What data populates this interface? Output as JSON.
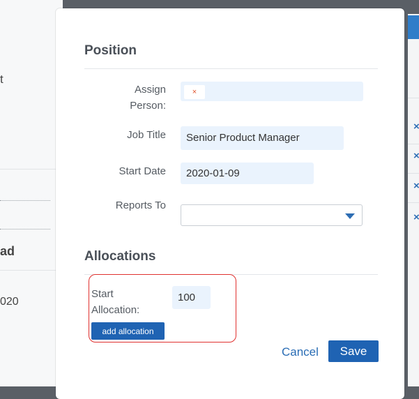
{
  "background": {
    "left_texts": [
      "t",
      "ad",
      "020"
    ]
  },
  "modal": {
    "position_section": {
      "title": "Position",
      "assign_person_label_line1": "Assign",
      "assign_person_label_line2": "Person:",
      "assign_person_chip_remove": "×",
      "job_title_label": "Job Title",
      "job_title_value": "Senior Product Manager",
      "start_date_label": "Start Date",
      "start_date_value": "2020-01-09",
      "reports_to_label": "Reports To",
      "reports_to_value": ""
    },
    "allocations_section": {
      "title": "Allocations",
      "start_allocation_label_line1": "Start",
      "start_allocation_label_line2": "Allocation:",
      "start_allocation_value": "100",
      "add_allocation_label": "add allocation"
    },
    "footer": {
      "cancel_label": "Cancel",
      "save_label": "Save"
    }
  },
  "colors": {
    "accent": "#1f63b3",
    "field_background": "#eaf3fd",
    "highlight_border": "#e0312f"
  }
}
